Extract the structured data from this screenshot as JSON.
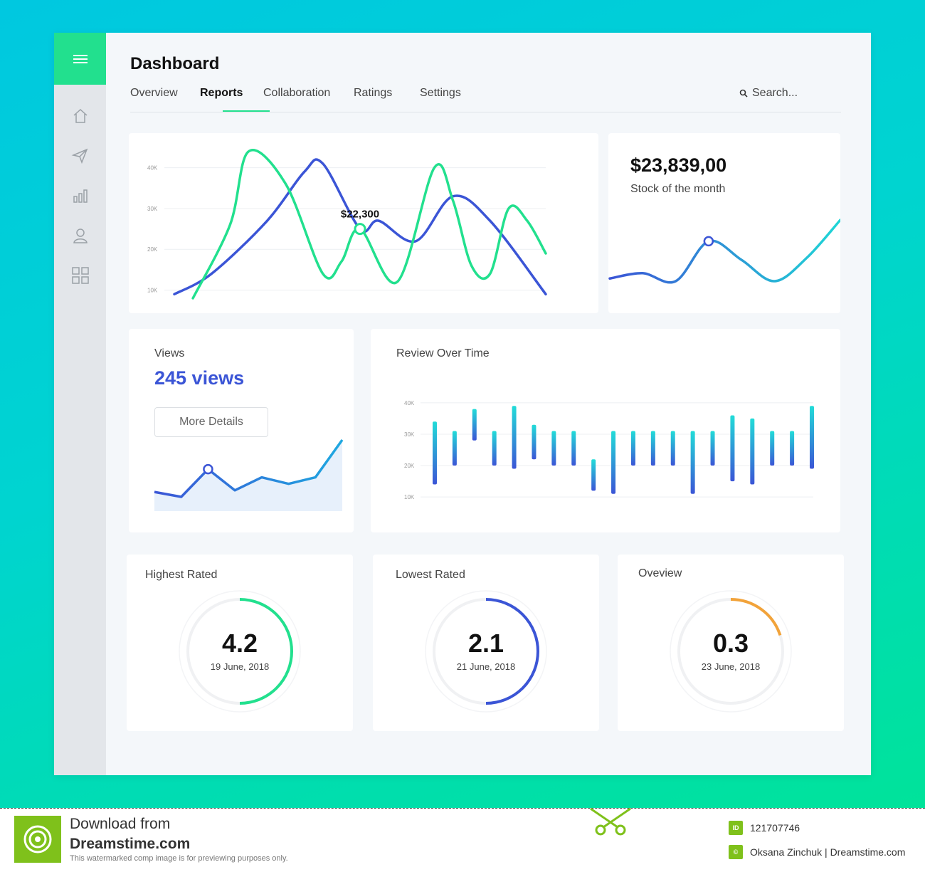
{
  "header": {
    "title": "Dashboard",
    "tabs": [
      {
        "label": "Overview",
        "active": false
      },
      {
        "label": "Reports",
        "active": true
      },
      {
        "label": "Collaboration",
        "active": false
      },
      {
        "label": "Ratings",
        "active": false
      },
      {
        "label": "Settings",
        "active": false
      }
    ],
    "search_placeholder": "Search..."
  },
  "sidebar": {
    "menu_icon": "hamburger-menu-icon",
    "items": [
      {
        "icon": "home-icon"
      },
      {
        "icon": "send-icon"
      },
      {
        "icon": "bar-chart-icon"
      },
      {
        "icon": "user-icon"
      },
      {
        "icon": "grid-icon"
      }
    ]
  },
  "colors": {
    "accent_green": "#22e08e",
    "accent_blue": "#3b55d6",
    "accent_cyan": "#1fc9d8",
    "accent_orange": "#f2a33a"
  },
  "stock": {
    "value": "$23,839,00",
    "label": "Stock of the month"
  },
  "views": {
    "title": "Views",
    "value": "245 views",
    "button": "More Details"
  },
  "review": {
    "title": "Review Over Time"
  },
  "gauges": [
    {
      "title": "Highest Rated",
      "value": "4.2",
      "date": "19 June, 2018",
      "fraction": 0.5,
      "color": "#22e08e"
    },
    {
      "title": "Lowest Rated",
      "value": "2.1",
      "date": "21 June, 2018",
      "fraction": 0.5,
      "color": "#3b55d6"
    },
    {
      "title": "Oveview",
      "value": "0.3",
      "date": "23 June, 2018",
      "fraction": 0.2,
      "color": "#f2a33a"
    }
  ],
  "chart_data": [
    {
      "type": "line",
      "title": "",
      "y_ticks": [
        "10K",
        "20K",
        "30K",
        "40K"
      ],
      "ylim": [
        8000,
        45000
      ],
      "xlim": [
        0,
        20
      ],
      "grid": true,
      "annotation": {
        "label": "$22,300",
        "x": 10,
        "y": 25000
      },
      "series": [
        {
          "color": "#3b55d6",
          "x": [
            0,
            2,
            5,
            7,
            8,
            10,
            11,
            13,
            15,
            17,
            20
          ],
          "y": [
            9000,
            14000,
            27000,
            39000,
            41000,
            25000,
            27000,
            22000,
            33000,
            27000,
            9000
          ]
        },
        {
          "color": "#22e08e",
          "x": [
            1,
            3,
            4,
            6,
            8,
            9,
            10,
            12,
            14,
            15,
            16,
            17,
            18,
            19,
            20
          ],
          "y": [
            8000,
            26000,
            44000,
            36000,
            14000,
            17000,
            25000,
            12000,
            40000,
            32000,
            16000,
            14000,
            30000,
            27000,
            19000
          ]
        }
      ]
    },
    {
      "type": "line",
      "title": "",
      "x": [
        0,
        1,
        2,
        3,
        4,
        5,
        6,
        7
      ],
      "series": [
        {
          "values": [
            10,
            12,
            9,
            24,
            17,
            9,
            18,
            32
          ]
        }
      ],
      "highlight_index": 3
    },
    {
      "type": "area",
      "title": "",
      "x": [
        0,
        1,
        2,
        3,
        4,
        5,
        6,
        7
      ],
      "series": [
        {
          "values": [
            14,
            11,
            28,
            15,
            23,
            19,
            23,
            46
          ]
        }
      ],
      "highlight_index": 2
    },
    {
      "type": "bar",
      "title": "Review Over Time",
      "y_ticks": [
        "10K",
        "20K",
        "30K",
        "40K"
      ],
      "ylim": [
        8000,
        42000
      ],
      "grid": true,
      "ranges": [
        [
          14000,
          34000
        ],
        [
          20000,
          31000
        ],
        [
          28000,
          38000
        ],
        [
          20000,
          31000
        ],
        [
          19000,
          39000
        ],
        [
          22000,
          33000
        ],
        [
          20000,
          31000
        ],
        [
          20000,
          31000
        ],
        [
          12000,
          22000
        ],
        [
          11000,
          31000
        ],
        [
          20000,
          31000
        ],
        [
          20000,
          31000
        ],
        [
          20000,
          31000
        ],
        [
          11000,
          31000
        ],
        [
          20000,
          31000
        ],
        [
          15000,
          36000
        ],
        [
          14000,
          35000
        ],
        [
          20000,
          31000
        ],
        [
          20000,
          31000
        ],
        [
          19000,
          39000
        ]
      ]
    }
  ],
  "footer": {
    "line1": "Download from",
    "line2": "Dreamstime.com",
    "line3": "This watermarked comp image is for previewing purposes only.",
    "id_badge": "ID",
    "id_value": "121707746",
    "author": "Oksana Zinchuk | Dreamstime.com"
  }
}
